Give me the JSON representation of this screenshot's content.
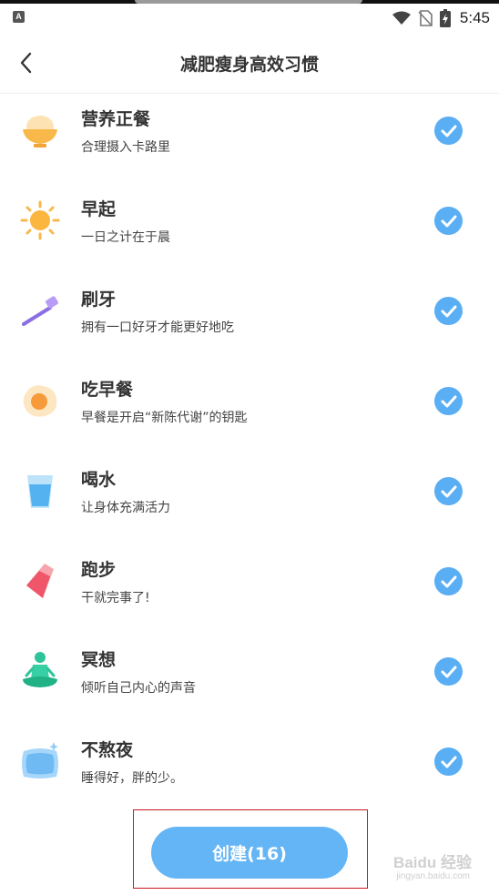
{
  "status_bar": {
    "time": "5:45"
  },
  "header": {
    "title": "减肥瘦身高效习惯"
  },
  "habits": [
    {
      "name": "营养正餐",
      "desc": "合理摄入卡路里",
      "icon": "bowl-icon",
      "checked": true
    },
    {
      "name": "早起",
      "desc": "一日之计在于晨",
      "icon": "sun-icon",
      "checked": true
    },
    {
      "name": "刷牙",
      "desc": "拥有一口好牙才能更好地吃",
      "icon": "toothbrush-icon",
      "checked": true
    },
    {
      "name": "吃早餐",
      "desc": "早餐是开启“新陈代谢”的钥匙",
      "icon": "fried-egg-icon",
      "checked": true
    },
    {
      "name": "喝水",
      "desc": "让身体充满活力",
      "icon": "water-cup-icon",
      "checked": true
    },
    {
      "name": "跑步",
      "desc": "干就完事了!",
      "icon": "sneaker-icon",
      "checked": true
    },
    {
      "name": "冥想",
      "desc": "倾听自己内心的声音",
      "icon": "meditation-icon",
      "checked": true
    },
    {
      "name": "不熬夜",
      "desc": "睡得好，胖的少。",
      "icon": "pillow-icon",
      "checked": true
    }
  ],
  "create_button": {
    "label": "创建(16)"
  },
  "watermark": {
    "text": "Baidu 经验",
    "sub": "jingyan.baidu.com"
  },
  "colors": {
    "accent": "#5aaef4",
    "button": "#64b5f6",
    "highlight_border": "#c9151e"
  }
}
